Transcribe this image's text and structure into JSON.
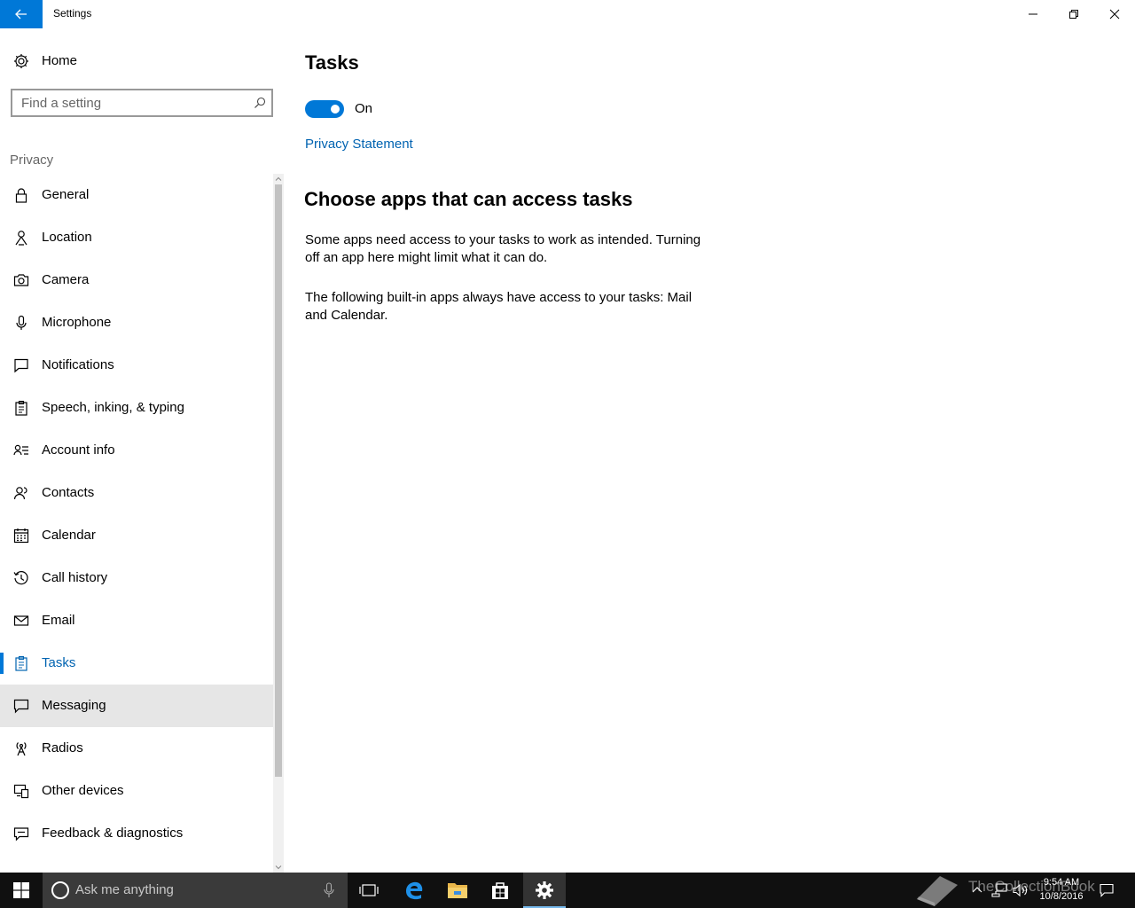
{
  "window": {
    "title": "Settings",
    "accent": "#0078d7"
  },
  "sidebar": {
    "home_label": "Home",
    "search_placeholder": "Find a setting",
    "section_label": "Privacy",
    "items": [
      {
        "label": "General",
        "icon": "lock-icon"
      },
      {
        "label": "Location",
        "icon": "location-icon"
      },
      {
        "label": "Camera",
        "icon": "camera-icon"
      },
      {
        "label": "Microphone",
        "icon": "microphone-icon"
      },
      {
        "label": "Notifications",
        "icon": "notifications-icon"
      },
      {
        "label": "Speech, inking, & typing",
        "icon": "clipboard-icon"
      },
      {
        "label": "Account info",
        "icon": "account-info-icon"
      },
      {
        "label": "Contacts",
        "icon": "contacts-icon"
      },
      {
        "label": "Calendar",
        "icon": "calendar-icon"
      },
      {
        "label": "Call history",
        "icon": "call-history-icon"
      },
      {
        "label": "Email",
        "icon": "email-icon"
      },
      {
        "label": "Tasks",
        "icon": "tasks-icon"
      },
      {
        "label": "Messaging",
        "icon": "messaging-icon"
      },
      {
        "label": "Radios",
        "icon": "radios-icon"
      },
      {
        "label": "Other devices",
        "icon": "other-devices-icon"
      },
      {
        "label": "Feedback & diagnostics",
        "icon": "feedback-icon"
      }
    ],
    "active_item": "Tasks",
    "hover_item": "Messaging"
  },
  "main": {
    "title": "Tasks",
    "toggle_state": "On",
    "privacy_link": "Privacy Statement",
    "section_heading": "Choose apps that can access tasks",
    "paragraph_1": "Some apps need access to your tasks to work as intended. Turning off an app here might limit what it can do.",
    "paragraph_2": "The following built-in apps always have access to your tasks: Mail and Calendar."
  },
  "taskbar": {
    "search_placeholder": "Ask me anything",
    "time": "9:54 AM",
    "date": "10/8/2016",
    "watermark": "TheCollectionBook"
  }
}
